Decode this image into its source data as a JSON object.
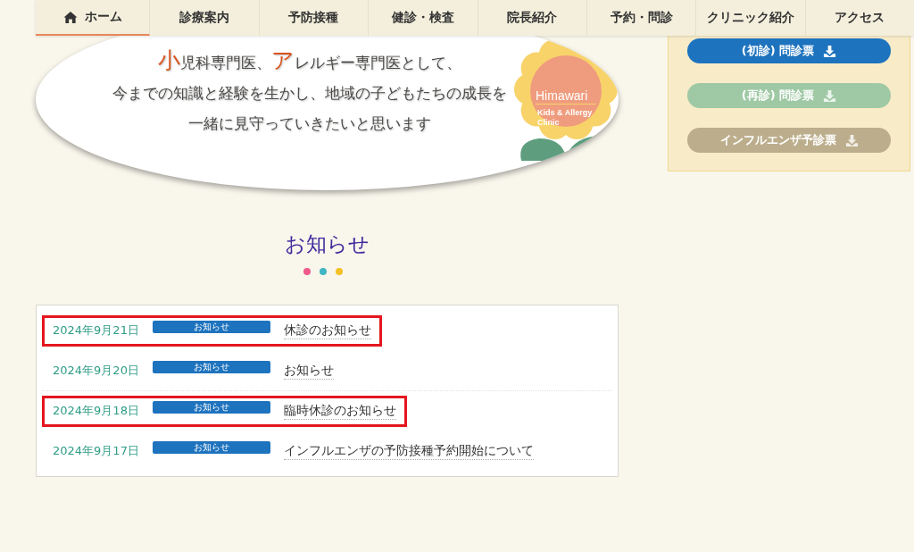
{
  "nav": [
    {
      "label": "ホーム",
      "kind": "home",
      "selected": true
    },
    {
      "label": "診療案内",
      "kind": "plain",
      "selected": false
    },
    {
      "label": "予防接種",
      "kind": "plain",
      "selected": false
    },
    {
      "label": "健診・検査",
      "kind": "plain",
      "selected": false
    },
    {
      "label": "院長紹介",
      "kind": "plain",
      "selected": false
    },
    {
      "label": "予約・問診",
      "kind": "plain",
      "selected": false
    },
    {
      "label": "クリニック紹介",
      "kind": "plain",
      "selected": false
    },
    {
      "label": "アクセス",
      "kind": "plain",
      "selected": false
    }
  ],
  "hero": {
    "lines": [
      "**小**児科専門医、**ア**レルギー専門医として、",
      "今までの知識と経験を生かし、地域の子どもたちの成長を",
      "一緒に見守っていきたいと思います"
    ],
    "logo": {
      "name": "Himawari",
      "subtitle": [
        "Kids & Allergy",
        "Clinic"
      ]
    }
  },
  "sidebar": {
    "buttons": [
      {
        "label": "(初診) 問診票",
        "disabled": false,
        "color": "#1e73be"
      },
      {
        "label": "(再診) 問診票",
        "disabled": true,
        "color": "#9fc9a5"
      },
      {
        "label": "インフルエンザ予診票",
        "disabled": true,
        "color": "#bcae8c"
      }
    ]
  },
  "news": {
    "title": "お知らせ",
    "items": [
      {
        "date": "2024年9月21日",
        "tag": "お知らせ",
        "title": "休診のお知らせ",
        "highlighted": true
      },
      {
        "date": "2024年9月20日",
        "tag": "お知らせ",
        "title": "お知らせ",
        "highlighted": false
      },
      {
        "date": "2024年9月18日",
        "tag": "お知らせ",
        "title": "臨時休診のお知らせ",
        "highlighted": true
      },
      {
        "date": "2024年9月17日",
        "tag": "お知らせ",
        "title": "インフルエンザの予防接種予約開始について",
        "highlighted": false
      }
    ]
  }
}
